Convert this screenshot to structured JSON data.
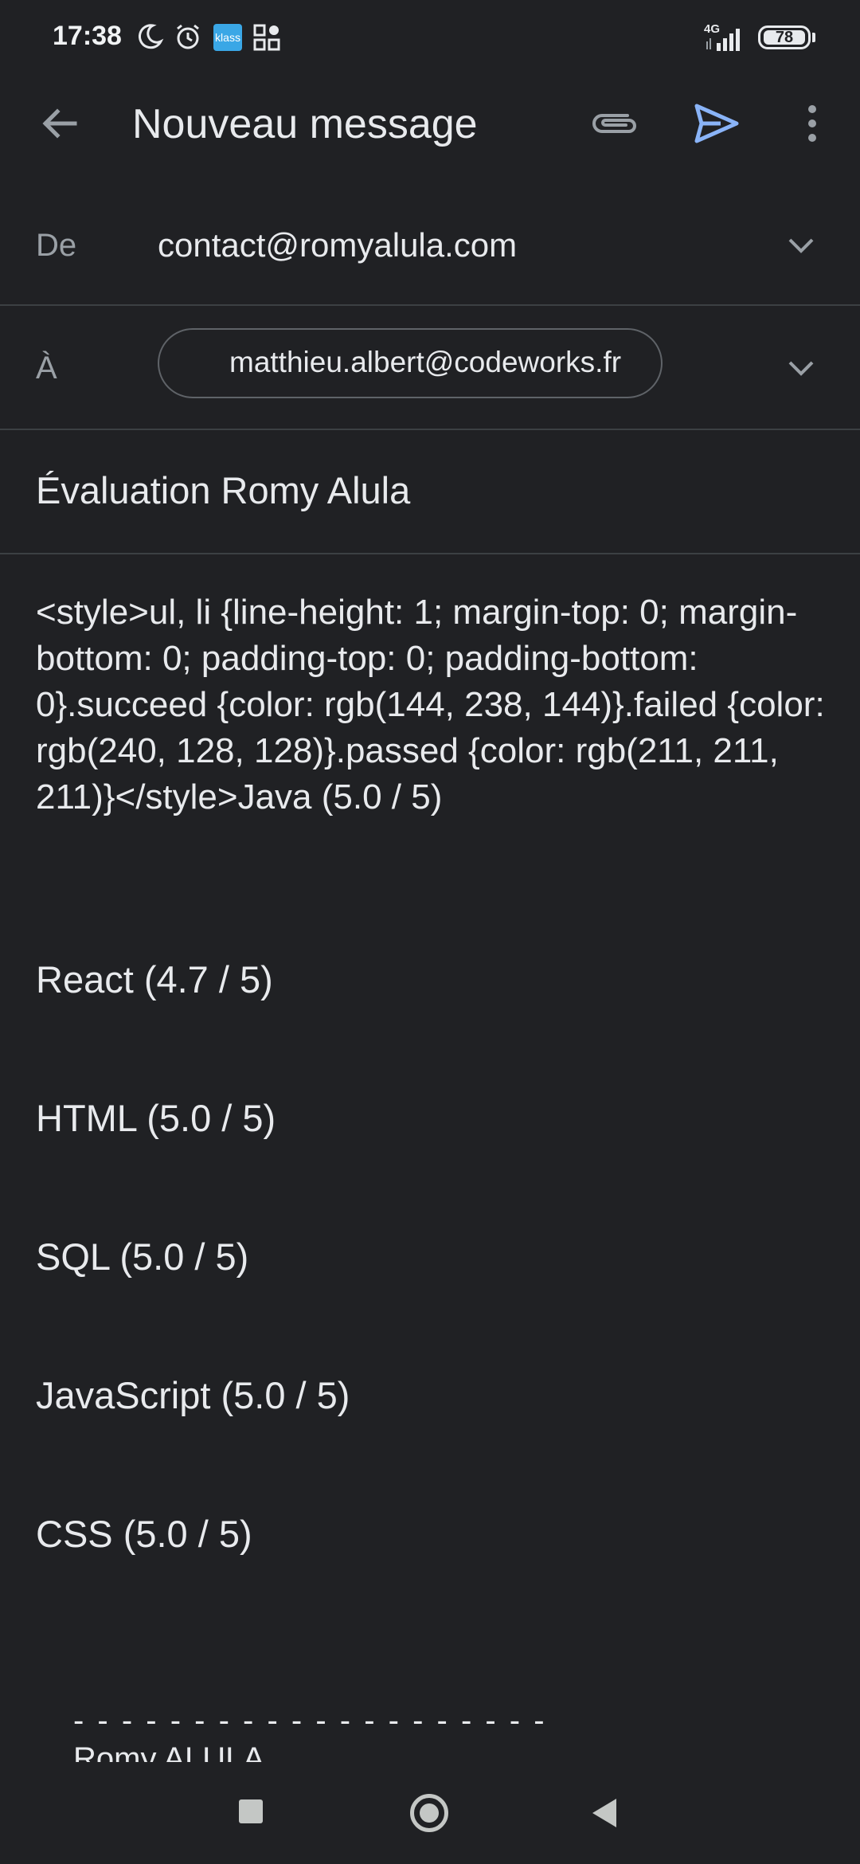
{
  "status_bar": {
    "time": "17:38",
    "klass_label": "klass",
    "network": "4G",
    "battery": "78",
    "icons": [
      "moon-icon",
      "alarm-icon",
      "klass-app-icon",
      "qr-scan-icon",
      "signal-icon",
      "battery-icon"
    ]
  },
  "app_bar": {
    "title": "Nouveau message",
    "icons": [
      "back-arrow-icon",
      "attachment-icon",
      "send-icon",
      "more-vert-icon"
    ],
    "accent": "#8ab4f8"
  },
  "from_field": {
    "label": "De",
    "value": "contact@romyalula.com"
  },
  "to_field": {
    "label": "À",
    "recipient": "matthieu.albert@codeworks.fr"
  },
  "subject": "Évaluation Romy Alula",
  "body": {
    "code": "<style>ul, li {line-height: 1; margin-top: 0; margin-bottom: 0; padding-top: 0; padding-bottom: 0}.succeed {color: rgb(144, 238, 144)}.failed {color: rgb(240, 128, 128)}.passed {color: rgb(211, 211, 211)}</style>Java (5.0 / 5)",
    "skills": [
      "React (4.7 / 5)",
      "HTML (5.0 / 5)",
      "SQL (5.0 / 5)",
      "JavaScript (5.0 / 5)",
      "CSS (5.0 / 5)"
    ],
    "signature_dashes": "- - - - - - - - - - - - - - - - - - - -",
    "signature_name": "Romy ALULA"
  },
  "nav_bar": {
    "icons": [
      "recents-square-icon",
      "home-circle-icon",
      "back-triangle-icon"
    ]
  }
}
